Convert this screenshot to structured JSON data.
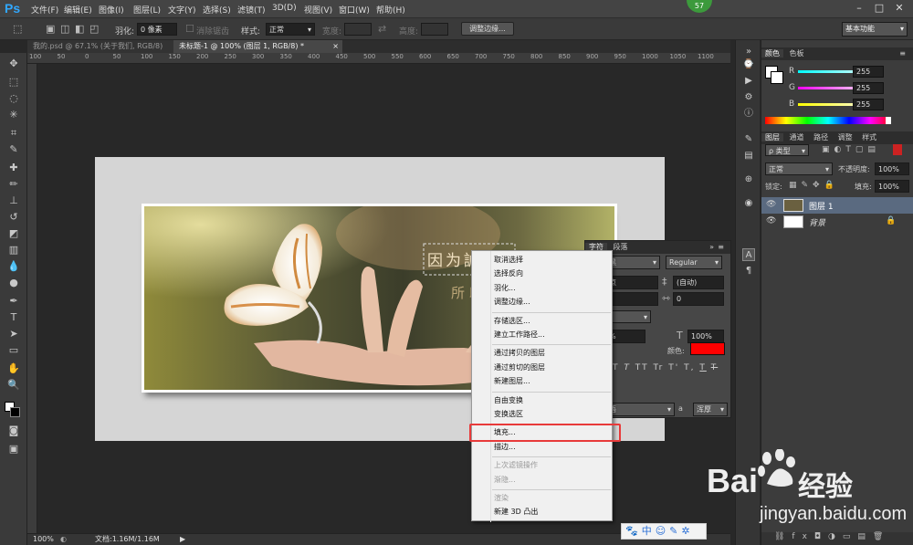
{
  "menubar": {
    "logo": "Ps",
    "items": [
      "文件(F)",
      "编辑(E)",
      "图像(I)",
      "图层(L)",
      "文字(Y)",
      "选择(S)",
      "滤镜(T)",
      "3D(D)",
      "视图(V)",
      "窗口(W)",
      "帮助(H)"
    ],
    "badge": "57"
  },
  "options": {
    "feather_label": "羽化:",
    "feather_value": "0 像素",
    "antialias_label": "消除锯齿",
    "style_label": "样式:",
    "style_value": "正常",
    "width_label": "宽度:",
    "height_label": "高度:",
    "refine_button": "调整边缘...",
    "workspace": "基本功能"
  },
  "doc_tabs": [
    "我的.psd @ 67.1% (关于我们, RGB/8)",
    "未标题-1 @ 100% (图层 1, RGB/8) *"
  ],
  "ruler_h": [
    "100",
    "50",
    "0",
    "50",
    "100",
    "150",
    "200",
    "250",
    "300",
    "350",
    "400",
    "450",
    "500",
    "550",
    "600",
    "650",
    "700",
    "750",
    "800",
    "850",
    "900",
    "950",
    "1000",
    "1050",
    "1100"
  ],
  "canvas": {
    "text1": "因为誠",
    "text2": "所以"
  },
  "status": {
    "zoom": "100%",
    "doc": "文档:1.16M/1.16M"
  },
  "color_panel": {
    "tabs": [
      "颜色",
      "色板"
    ],
    "channels": [
      {
        "name": "R",
        "value": "255",
        "accent": "#ff4040"
      },
      {
        "name": "G",
        "value": "255",
        "accent": "#40c040"
      },
      {
        "name": "B",
        "value": "255",
        "accent": "#4060ff"
      }
    ]
  },
  "layers_panel": {
    "tabs": [
      "图层",
      "通道",
      "路径",
      "调整",
      "样式"
    ],
    "filter": "ρ 类型",
    "blend_mode": "正常",
    "opacity_label": "不透明度:",
    "opacity_value": "100%",
    "lock_label": "锁定:",
    "fill_label": "填充:",
    "fill_value": "100%",
    "layers": [
      {
        "name": "图层 1",
        "selected": true
      },
      {
        "name": "背景",
        "selected": false
      }
    ]
  },
  "char_panel": {
    "tabs": [
      "字符",
      "段落"
    ],
    "font_family": "黑",
    "font_style": "Regular",
    "size": "点",
    "leading": "(自动)",
    "tracking": "0",
    "vscale": "%",
    "hscale": "100%",
    "color_label": "颜色:",
    "color": "#ff0000",
    "glyphs": [
      "T",
      "T",
      "TT",
      "Tr",
      "T'",
      "T,",
      "T",
      "T"
    ],
    "language": "语",
    "aa_label": "a",
    "aa_value": "浑厚"
  },
  "context_menu": {
    "items": [
      {
        "label": "取消选择",
        "disabled": false,
        "sep_before": false
      },
      {
        "label": "选择反向",
        "disabled": false,
        "sep_before": false
      },
      {
        "label": "羽化...",
        "disabled": false,
        "sep_before": false
      },
      {
        "label": "调整边缘...",
        "disabled": false,
        "sep_before": false
      },
      {
        "label": "存储选区...",
        "disabled": false,
        "sep_before": true
      },
      {
        "label": "建立工作路径...",
        "disabled": false,
        "sep_before": false
      },
      {
        "label": "通过拷贝的图层",
        "disabled": false,
        "sep_before": true
      },
      {
        "label": "通过剪切的图层",
        "disabled": false,
        "sep_before": false
      },
      {
        "label": "新建图层...",
        "disabled": false,
        "sep_before": false
      },
      {
        "label": "自由变换",
        "disabled": false,
        "sep_before": true
      },
      {
        "label": "变换选区",
        "disabled": false,
        "sep_before": false
      },
      {
        "label": "填充...",
        "disabled": false,
        "sep_before": true
      },
      {
        "label": "描边...",
        "disabled": false,
        "sep_before": false
      },
      {
        "label": "上次滤镜操作",
        "disabled": true,
        "sep_before": true
      },
      {
        "label": "渐隐...",
        "disabled": true,
        "sep_before": false
      },
      {
        "label": "渲染",
        "disabled": true,
        "sep_before": true
      },
      {
        "label": "新建 3D 凸出",
        "disabled": false,
        "sep_before": false
      }
    ]
  },
  "watermark": {
    "brand": "Bai",
    "brand2": "经验",
    "url": "jingyan.baidu.com",
    "bar": "中"
  }
}
